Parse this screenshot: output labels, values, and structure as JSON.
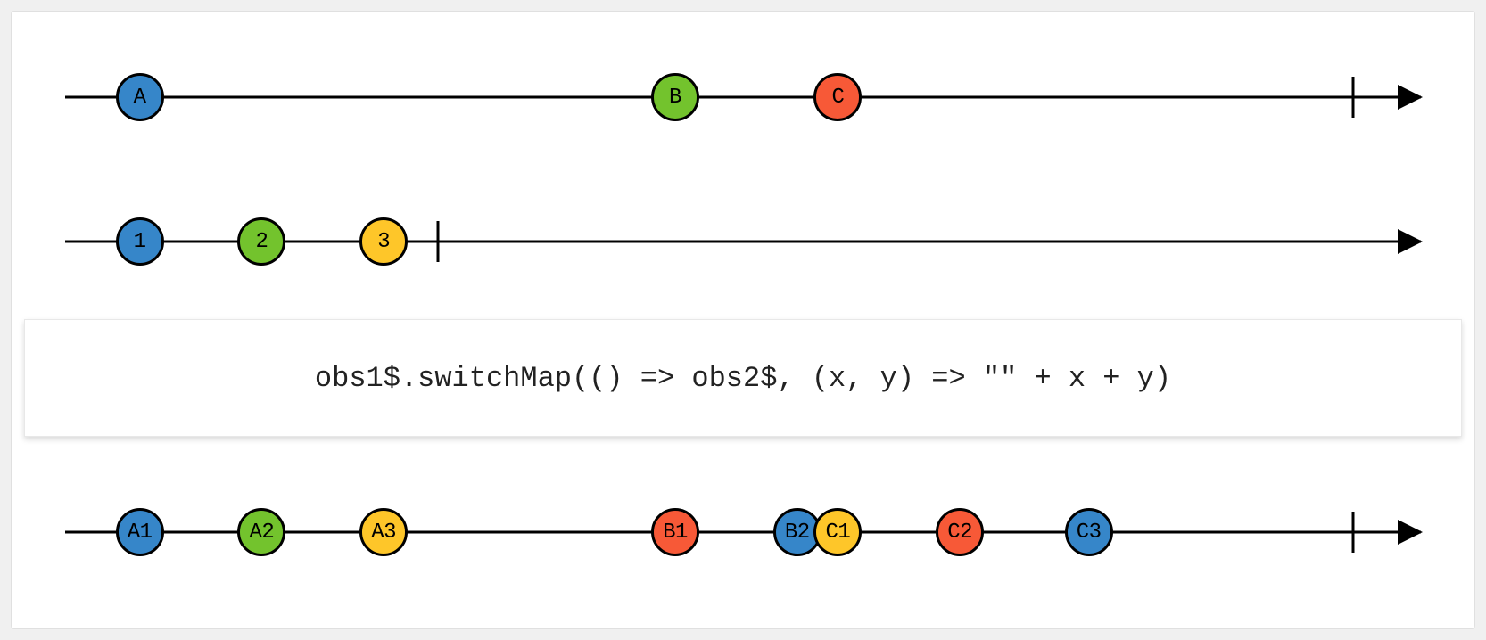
{
  "colors": {
    "blue": "#3686c9",
    "green": "#73c32d",
    "yellow": "#fec629",
    "red": "#f75937"
  },
  "operator": "obs1$.switchMap(() => obs2$, (x, y) => \"\" + x + y)",
  "track1": {
    "marbles": [
      {
        "label": "A",
        "x": 5.5,
        "color": "blue"
      },
      {
        "label": "B",
        "x": 45.0,
        "color": "green"
      },
      {
        "label": "C",
        "x": 57.0,
        "color": "red"
      }
    ],
    "end_tick_x": 95.0,
    "arrow": true
  },
  "track2": {
    "marbles": [
      {
        "label": "1",
        "x": 5.5,
        "color": "blue"
      },
      {
        "label": "2",
        "x": 14.5,
        "color": "green"
      },
      {
        "label": "3",
        "x": 23.5,
        "color": "yellow"
      }
    ],
    "end_tick_x": 27.5,
    "arrow": true
  },
  "track3": {
    "marbles": [
      {
        "label": "A1",
        "x": 5.5,
        "color": "blue"
      },
      {
        "label": "A2",
        "x": 14.5,
        "color": "green"
      },
      {
        "label": "A3",
        "x": 23.5,
        "color": "yellow"
      },
      {
        "label": "B1",
        "x": 45.0,
        "color": "red"
      },
      {
        "label": "B2",
        "x": 54.0,
        "color": "blue"
      },
      {
        "label": "C1",
        "x": 57.0,
        "color": "yellow"
      },
      {
        "label": "C2",
        "x": 66.0,
        "color": "red"
      },
      {
        "label": "C3",
        "x": 75.5,
        "color": "blue"
      }
    ],
    "end_tick_x": 95.0,
    "arrow": true
  }
}
